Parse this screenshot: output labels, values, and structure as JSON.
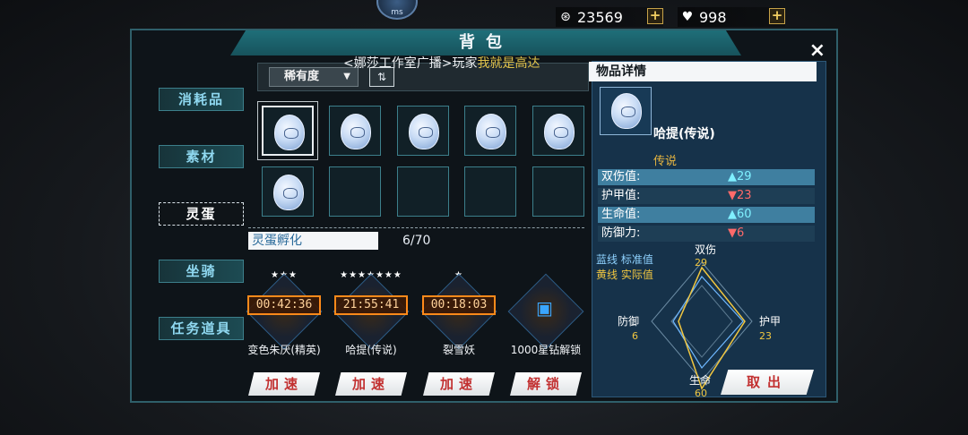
{
  "status": {
    "ping_unit": "ms"
  },
  "currency": {
    "coins": "23569",
    "gems": "998"
  },
  "window": {
    "title": "背包",
    "close": "×"
  },
  "nav": [
    "消耗品",
    "素材",
    "灵蛋",
    "坐骑",
    "任务道具"
  ],
  "sort": {
    "label": "稀有度",
    "toggle": "⇅"
  },
  "grid": {
    "filled_slots": 6,
    "empty_slots": 4
  },
  "broadcast": {
    "prefix": "<娜莎工作室广播>玩家",
    "highlight": "我就是高达"
  },
  "hatch": {
    "title": "灵蛋孵化",
    "count": "6/70",
    "slots": [
      {
        "stars": "★★★",
        "timer": "00:42:36",
        "name": "变色朱厌(精英)",
        "button": "加速"
      },
      {
        "stars": "★★★★★★★",
        "timer": "21:55:41",
        "name": "哈提(传说)",
        "button": "加速"
      },
      {
        "stars": "★",
        "timer": "00:18:03",
        "name": "裂雪妖",
        "button": "加速"
      },
      {
        "stars": "",
        "timer": "",
        "name": "1000星钻解锁",
        "button": "解锁"
      }
    ]
  },
  "detail": {
    "header": "物品详情",
    "name": "哈提(传说)",
    "rarity": "传说",
    "stats": [
      {
        "label": "双伤值:",
        "arrow": "▲",
        "value": "29",
        "dir": "up"
      },
      {
        "label": "护甲值:",
        "arrow": "▼",
        "value": "23",
        "dir": "down"
      },
      {
        "label": "生命值:",
        "arrow": "▲",
        "value": "60",
        "dir": "up"
      },
      {
        "label": "防御力:",
        "arrow": "▼",
        "value": "6",
        "dir": "down"
      }
    ],
    "legend_blue": "蓝线 标准值",
    "legend_yellow": "黄线 实际值",
    "radar": {
      "axes": [
        "双伤",
        "护甲",
        "生命",
        "防御"
      ],
      "values": [
        "29",
        "23",
        "60",
        "6"
      ]
    },
    "takeout": "取出"
  },
  "colors": {
    "accent": "#1f6f79",
    "timer": "#ff8a1a",
    "gold": "#f0c640"
  }
}
